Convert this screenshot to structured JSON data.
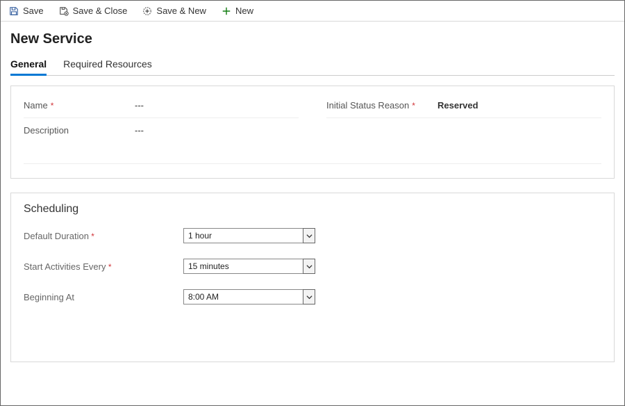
{
  "toolbar": {
    "save": "Save",
    "saveClose": "Save & Close",
    "saveNew": "Save & New",
    "new": "New"
  },
  "page": {
    "title": "New Service"
  },
  "tabs": {
    "general": "General",
    "requiredResources": "Required Resources"
  },
  "fields": {
    "name": {
      "label": "Name",
      "value": "---"
    },
    "initialStatus": {
      "label": "Initial Status Reason",
      "value": "Reserved"
    },
    "description": {
      "label": "Description",
      "value": "---"
    }
  },
  "scheduling": {
    "title": "Scheduling",
    "defaultDuration": {
      "label": "Default Duration",
      "value": "1 hour"
    },
    "startEvery": {
      "label": "Start Activities Every",
      "value": "15 minutes"
    },
    "beginningAt": {
      "label": "Beginning At",
      "value": "8:00 AM"
    }
  }
}
